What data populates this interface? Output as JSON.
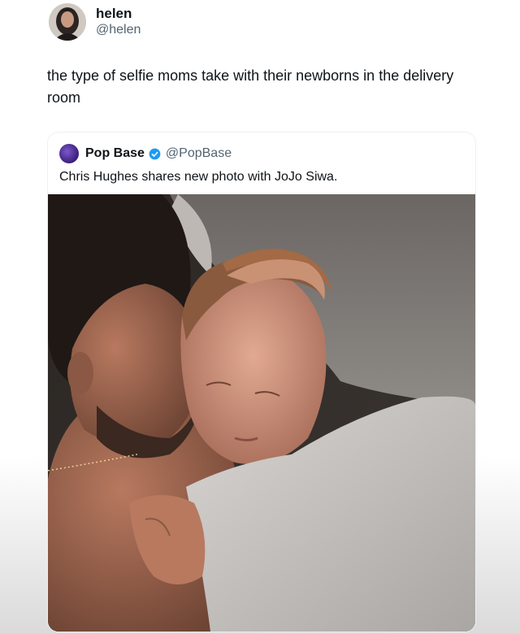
{
  "tweet": {
    "display_name": "helen",
    "handle": "@helen",
    "avatar_icon": "profile-photo",
    "text": "the type of selfie moms take with their newborns in the delivery room"
  },
  "quote": {
    "display_name": "Pop Base",
    "handle": "@PopBase",
    "verified_icon": "verified-badge-icon",
    "verified_color": "#1d9bf0",
    "text": "Chris Hughes shares new photo with JoJo Siwa."
  },
  "colors": {
    "text_primary": "#0f1419",
    "text_secondary": "#536471",
    "background": "#ffffff"
  }
}
